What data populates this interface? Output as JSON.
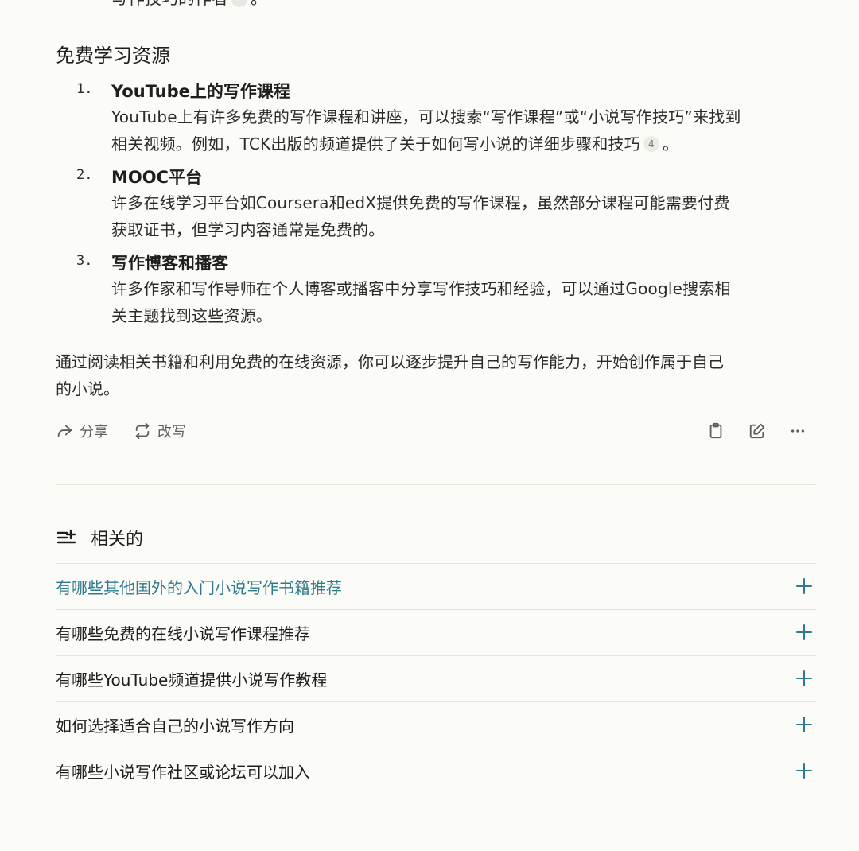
{
  "top_partial": "写作技巧的作者",
  "top_partial_end": "。",
  "section": {
    "heading": "免费学习资源",
    "items": [
      {
        "num": "1.",
        "title": "YouTube上的写作课程",
        "desc_line1": "YouTube上有许多免费的写作课程和讲座，可以搜索“写作课程”或“小说写作技巧”来找到",
        "desc_line2": "相关视频。例如，TCK出版的频道提供了关于如何写小说的详细步骤和技巧",
        "citation": "4",
        "desc_end": "。"
      },
      {
        "num": "2.",
        "title": "MOOC平台",
        "desc_line1": "许多在线学习平台如Coursera和edX提供免费的写作课程，虽然部分课程可能需要付费",
        "desc_line2": "获取证书，但学习内容通常是免费的。"
      },
      {
        "num": "3.",
        "title": "写作博客和播客",
        "desc_line1": "许多作家和写作导师在个人博客或播客中分享写作技巧和经验，可以通过Google搜索相",
        "desc_line2": "关主题找到这些资源。"
      }
    ]
  },
  "conclusion_line1": "通过阅读相关书籍和利用免费的在线资源，你可以逐步提升自己的写作能力，开始创作属于自己",
  "conclusion_line2": "的小说。",
  "actions": {
    "share": "分享",
    "rewrite": "改写"
  },
  "related": {
    "title": "相关的",
    "items": [
      "有哪些其他国外的入门小说写作书籍推荐",
      "有哪些免费的在线小说写作课程推荐",
      "有哪些YouTube频道提供小说写作教程",
      "如何选择适合自己的小说写作方向",
      "有哪些小说写作社区或论坛可以加入"
    ]
  },
  "colors": {
    "background": "#fbfbf8",
    "accent": "#2f7b8c",
    "text": "#1d1f1f",
    "muted": "#5c5f5f"
  }
}
